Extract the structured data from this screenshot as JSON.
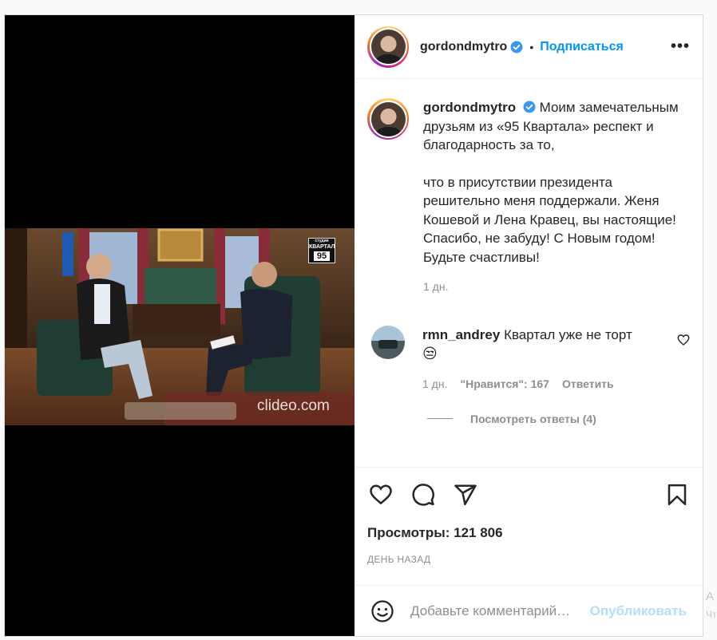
{
  "post": {
    "author": {
      "username": "gordondmytro",
      "verified": true
    },
    "header": {
      "dot": "•",
      "follow_label": "Подписаться",
      "more_label": "•••"
    },
    "caption": {
      "username": "gordondmytro",
      "text": "Моим замечательным друзьям из «95 Квартала» респект и благодарность за то,",
      "text_continued": "что в присутствии президента решительно меня поддержали. Женя Кошевой и Лена Кравец, вы настоящие! Спасибо, не забуду! С Новым годом! Будьте счастливы!",
      "time": "1 дн."
    },
    "comments": [
      {
        "username": "rmn_andrey",
        "text": "Квартал уже не торт",
        "emoji": "😒",
        "time": "1 дн.",
        "likes_label": "\"Нравится\": 167",
        "reply_label": "Ответить",
        "view_replies_label": "Посмотреть ответы (4)"
      }
    ],
    "video": {
      "watermark": "clideo.com",
      "logo_top": "студия",
      "logo_main": "КВАРТАЛ",
      "logo_num": "95"
    },
    "stats": {
      "views": "Просмотры: 121 806",
      "posted_ago": "ДЕНЬ НАЗАД"
    },
    "add_comment": {
      "placeholder": "Добавьте комментарий…",
      "publish_label": "Опубликовать"
    },
    "edge_text": {
      "line1": "А",
      "line2": "Чт"
    }
  }
}
